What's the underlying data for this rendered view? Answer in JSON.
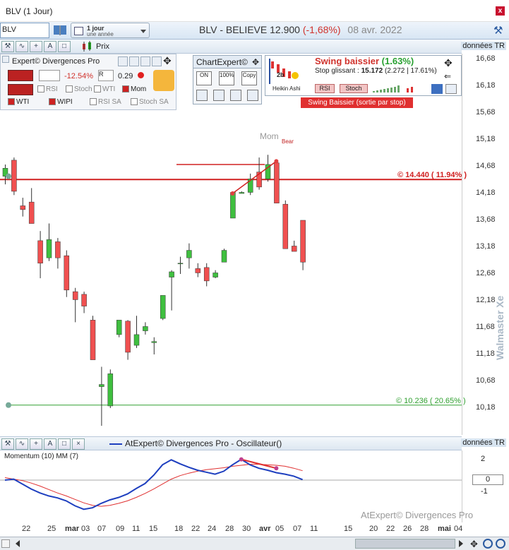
{
  "window": {
    "title": "BLV (1 Jour)",
    "close_icon": "close-icon"
  },
  "toolbar": {
    "symbol": "BLV",
    "period_main": "1 jour",
    "period_sub": "une année",
    "instrument": "BLV - BELIEVE",
    "price": "12.900",
    "change": "(-1,68%)",
    "date": "08 avr. 2022"
  },
  "chartbar": {
    "price_label": "Prix",
    "data_label": "données TR"
  },
  "panel_expert": {
    "title": "Expert© Divergences Pro",
    "pct": "-12.54%",
    "ratio": "0.29",
    "checks": [
      {
        "label": "RSI",
        "checked": false
      },
      {
        "label": "Stoch",
        "checked": false
      },
      {
        "label": "WTI",
        "checked": false
      },
      {
        "label": "Mom",
        "checked": true
      }
    ],
    "bottom_checks": [
      {
        "label": "WTI",
        "checked": true
      },
      {
        "label": "WIPI",
        "checked": true
      },
      {
        "label": "RSI SA",
        "checked": false
      },
      {
        "label": "Stoch SA",
        "checked": false
      }
    ]
  },
  "panel_chartexpert": {
    "title": "ChartExpert©",
    "btn1": "ON",
    "btn2": "100%",
    "btn3": "Copy"
  },
  "swing": {
    "title": "Swing baissier",
    "pct": "(1.63%)",
    "stop_label": "Stop glissant :",
    "stop_value": "15.172",
    "stop_detail": "(2.272 | 17.61%)",
    "btn_rsi": "RSI",
    "btn_stoch": "Stoch",
    "heikin": "Heikin Ashi",
    "badge": "Swing Baissier (sortie par stop)",
    "days": "2b"
  },
  "annotations": {
    "mom": "Mom",
    "bear": "Bear",
    "resistance": "© 14.440 ( 11.94% )",
    "support": "© 10.236 ( 20.65% )"
  },
  "yaxis": [
    "16,68",
    "16,18",
    "15,68",
    "15,18",
    "14,68",
    "14,18",
    "13,68",
    "13,18",
    "12,68",
    "12,18",
    "11,68",
    "11,18",
    "10,68",
    "10,18"
  ],
  "oscillator": {
    "title": "AtExpert© Divergences Pro - Oscillateur()",
    "data_label": "données TR",
    "indicator": "Momentum (10) MM (7)",
    "watermark": "AtExpert© Divergences Pro",
    "levels": [
      "2",
      "0",
      "-1"
    ]
  },
  "xaxis": [
    "22",
    "25",
    "mar",
    "03",
    "07",
    "09",
    "11",
    "15",
    "18",
    "22",
    "24",
    "28",
    "30",
    "avr",
    "05",
    "07",
    "11",
    "15",
    "20",
    "22",
    "26",
    "28",
    "mai",
    "04"
  ],
  "watermark": "Walmaster Xe",
  "candles": [
    {
      "o": 14.5,
      "h": 14.72,
      "l": 14.35,
      "c": 14.65
    },
    {
      "o": 14.8,
      "h": 14.85,
      "l": 14.15,
      "c": 14.22
    },
    {
      "o": 13.95,
      "h": 14.1,
      "l": 13.75,
      "c": 13.88
    },
    {
      "o": 14.02,
      "h": 14.28,
      "l": 13.85,
      "c": 13.62
    },
    {
      "o": 13.3,
      "h": 13.48,
      "l": 12.6,
      "c": 12.88
    },
    {
      "o": 12.98,
      "h": 13.62,
      "l": 12.92,
      "c": 13.32
    },
    {
      "o": 13.28,
      "h": 13.35,
      "l": 12.78,
      "c": 12.98
    },
    {
      "o": 13.02,
      "h": 13.12,
      "l": 12.25,
      "c": 12.38
    },
    {
      "o": 12.35,
      "h": 12.42,
      "l": 11.78,
      "c": 12.2
    },
    {
      "o": 12.3,
      "h": 12.35,
      "l": 11.95,
      "c": 12.08
    },
    {
      "o": 11.82,
      "h": 11.9,
      "l": 11.08,
      "c": 11.08
    },
    {
      "o": 10.58,
      "h": 10.95,
      "l": 9.85,
      "c": 10.62
    },
    {
      "o": 10.22,
      "h": 10.9,
      "l": 10.18,
      "c": 10.82
    },
    {
      "o": 11.55,
      "h": 11.82,
      "l": 11.5,
      "c": 11.82
    },
    {
      "o": 11.8,
      "h": 11.82,
      "l": 11.08,
      "c": 11.22
    },
    {
      "o": 11.35,
      "h": 11.9,
      "l": 11.3,
      "c": 11.55
    },
    {
      "o": 11.62,
      "h": 11.78,
      "l": 11.55,
      "c": 11.7
    },
    {
      "o": 11.4,
      "h": 11.5,
      "l": 11.18,
      "c": 11.42
    },
    {
      "o": 11.85,
      "h": 12.28,
      "l": 11.82,
      "c": 12.28
    },
    {
      "o": 12.62,
      "h": 12.75,
      "l": 12.0,
      "c": 12.72
    },
    {
      "o": 12.88,
      "h": 13.0,
      "l": 12.68,
      "c": 12.88
    },
    {
      "o": 12.98,
      "h": 13.25,
      "l": 12.78,
      "c": 13.12
    },
    {
      "o": 12.78,
      "h": 12.88,
      "l": 12.62,
      "c": 12.7
    },
    {
      "o": 12.8,
      "h": 12.88,
      "l": 12.45,
      "c": 12.55
    },
    {
      "o": 12.62,
      "h": 12.75,
      "l": 12.6,
      "c": 12.7
    },
    {
      "o": 12.9,
      "h": 13.15,
      "l": 12.9,
      "c": 13.12
    },
    {
      "o": 13.72,
      "h": 14.22,
      "l": 13.72,
      "c": 14.2
    },
    {
      "o": 14.18,
      "h": 14.22,
      "l": 14.18,
      "c": 14.2
    },
    {
      "o": 14.2,
      "h": 14.55,
      "l": 14.15,
      "c": 14.45
    },
    {
      "o": 14.58,
      "h": 14.85,
      "l": 14.25,
      "c": 14.3
    },
    {
      "o": 14.45,
      "h": 14.9,
      "l": 14.4,
      "c": 14.72
    },
    {
      "o": 14.75,
      "h": 14.8,
      "l": 14.0,
      "c": 14.0
    },
    {
      "o": 13.98,
      "h": 14.05,
      "l": 13.15,
      "c": 13.15
    },
    {
      "o": 13.2,
      "h": 13.3,
      "l": 13.1,
      "c": 13.1
    },
    {
      "o": 13.68,
      "h": 13.68,
      "l": 12.75,
      "c": 12.9
    }
  ],
  "colors": {
    "up": "#3fbf3f",
    "down": "#f05050",
    "resistance": "#d02020",
    "support": "#30a030",
    "osc_main": "#1e3fbf",
    "osc_signal": "#e03030"
  }
}
